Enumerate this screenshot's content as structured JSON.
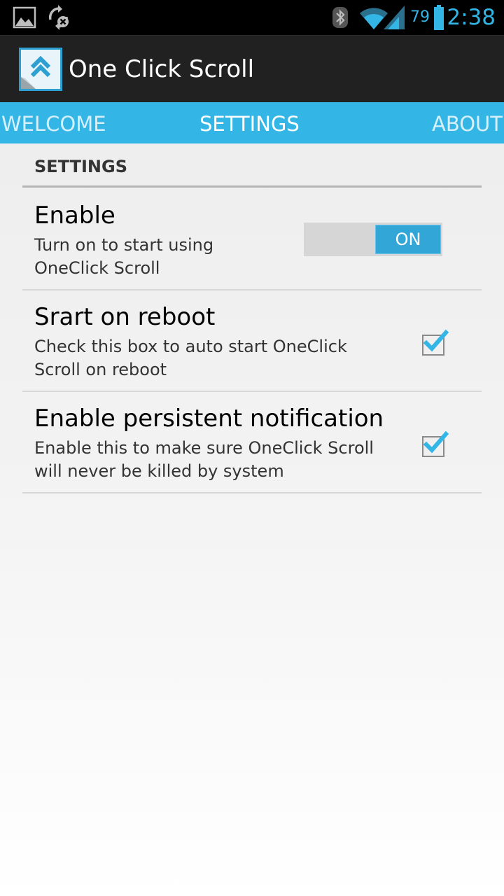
{
  "status_bar": {
    "battery_percent": "79",
    "time": "2:38",
    "icons": [
      "picture-icon",
      "sync-error-icon",
      "bluetooth-icon",
      "wifi-icon",
      "signal-icon",
      "battery-icon"
    ]
  },
  "action_bar": {
    "title": "One Click Scroll",
    "icon": "app-logo-icon"
  },
  "tabs": [
    {
      "label": "WELCOME",
      "active": false
    },
    {
      "label": "SETTINGS",
      "active": true
    },
    {
      "label": "ABOUT",
      "active": false
    }
  ],
  "settings": {
    "section_header": "SETTINGS",
    "preferences": [
      {
        "title": "Enable",
        "summary": "Turn on to start using OneClick Scroll",
        "control": "toggle",
        "toggle_label": "ON",
        "value": true
      },
      {
        "title": "Srart on reboot",
        "summary": "Check this box to auto start OneClick Scroll on reboot",
        "control": "checkbox",
        "value": true
      },
      {
        "title": "Enable persistent notification",
        "summary": "Enable this to make sure OneClick Scroll will never be killed by system",
        "control": "checkbox",
        "value": true
      }
    ]
  },
  "colors": {
    "accent": "#33b5e5",
    "action_bar": "#212121",
    "status_bar": "#000000",
    "toggle_on": "#33a6d8"
  }
}
